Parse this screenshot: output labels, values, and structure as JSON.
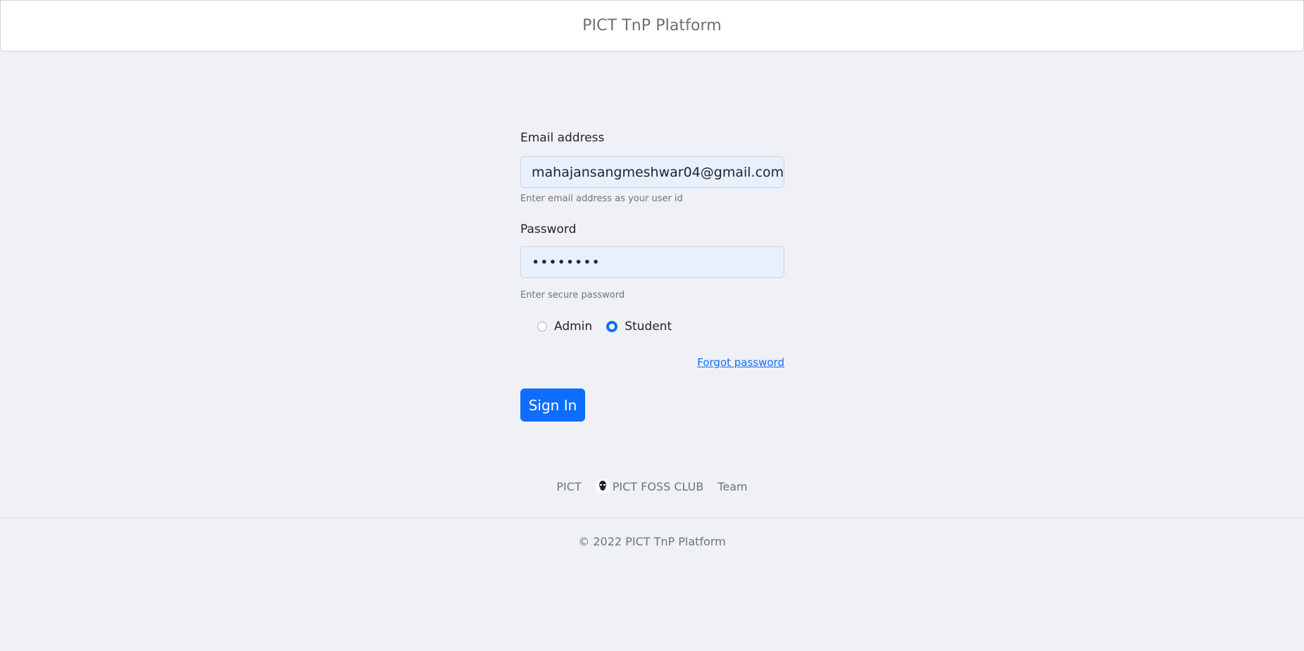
{
  "header": {
    "brand": "PICT TnP Platform"
  },
  "form": {
    "email_label": "Email address",
    "email_value": "mahajansangmeshwar04@gmail.com",
    "email_help": "Enter email address as your user id",
    "password_label": "Password",
    "password_value": "••••••••",
    "password_help": "Enter secure password",
    "roles": [
      {
        "label": "Admin",
        "checked": false
      },
      {
        "label": "Student",
        "checked": true
      }
    ],
    "forgot_label": "Forgot password",
    "submit_label": "Sign In"
  },
  "footer": {
    "links": [
      {
        "label": "PICT"
      },
      {
        "label": "PICT FOSS CLUB",
        "icon": "foss-club-logo-icon"
      },
      {
        "label": "Team"
      }
    ],
    "copyright": "© 2022 PICT TnP Platform"
  },
  "colors": {
    "background": "#eff1f6",
    "primary": "#0d6efd",
    "input_autofill": "#e8f0fe"
  }
}
